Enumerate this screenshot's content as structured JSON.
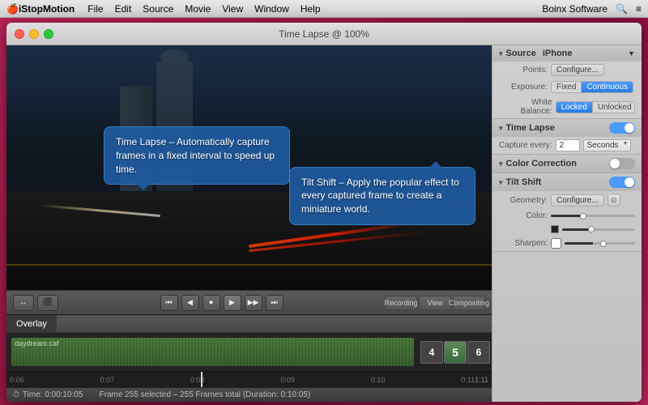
{
  "menubar": {
    "apple": "🍎",
    "appName": "iStopMotion",
    "menus": [
      "File",
      "Edit",
      "Source",
      "Movie",
      "View",
      "Window",
      "Help"
    ],
    "right": {
      "brand": "Boinx Software",
      "search": "🔍",
      "menu": "≡"
    }
  },
  "titlebar": {
    "title": "Time Lapse @ 100%"
  },
  "tooltips": {
    "timelapse": "Time Lapse – Automatically capture frames in a fixed interval to speed up time.",
    "tiltshift": "Tilt Shift – Apply the popular effect to every captured frame to create a miniature world."
  },
  "rightPanel": {
    "source": {
      "label": "Source",
      "device": "iPhone",
      "pointsLabel": "Points:",
      "configureBtn": "Configure...",
      "exposureLabel": "Exposure:",
      "segButtons": [
        "Fixed",
        "Continuous"
      ],
      "whiteBalanceLabel": "White Balance:",
      "wbButtons": [
        "Locked",
        "Unlocked"
      ]
    },
    "timelapse": {
      "label": "Time Lapse",
      "captureEveryLabel": "Capture every:",
      "captureValue": "2",
      "unit": "Seconds"
    },
    "colorCorrection": {
      "label": "Color Correction"
    },
    "tiltShift": {
      "label": "Tilt Shift",
      "geometryLabel": "Geometry:",
      "geometryBtn": "Configure...",
      "colorLabel": "Color:",
      "sharpenLabel": "Sharpen:"
    }
  },
  "timeline": {
    "trackLabel": "daydream.caf",
    "tab": "Overlay",
    "tabIcons": [
      "Recording",
      "View",
      "Compositing"
    ],
    "rulerMarks": [
      "0:06",
      "0:07",
      "0:08",
      "0:09",
      "0:10",
      "0:11"
    ],
    "frameNumbers": [
      "4",
      "5",
      "6"
    ],
    "timeEnd": "1:11"
  },
  "statusbar": {
    "icon": "⏱",
    "time": "Time: 0:00:10:05",
    "frameInfo": "Frame 255 selected – 255 Frames total (Duration: 0:10:05)"
  },
  "transportControls": {
    "rewind": "⏮",
    "back": "◀",
    "record": "⏺",
    "play": "▶",
    "forward": "▶▶",
    "end": "⏭"
  }
}
